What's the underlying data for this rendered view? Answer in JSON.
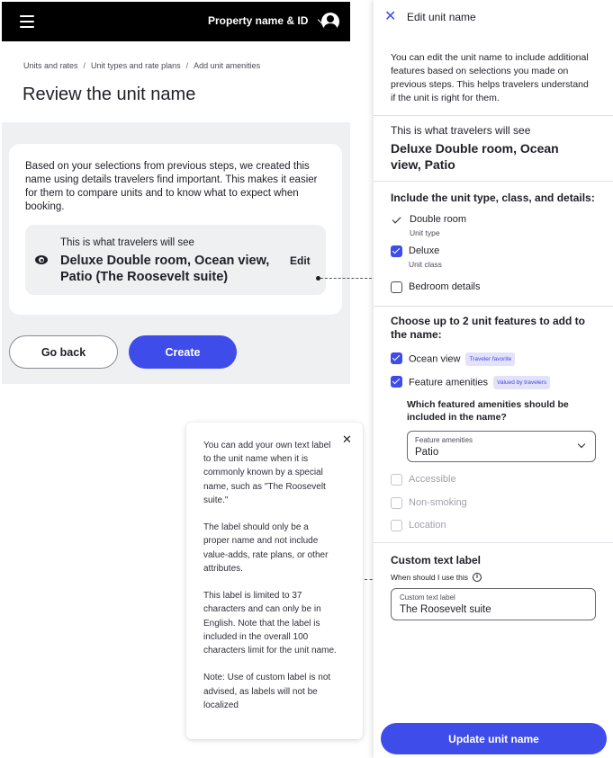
{
  "topbar": {
    "property_label": "Property name & ID"
  },
  "breadcrumb": [
    "Units and rates",
    "Unit types and rate plans",
    "Add unit amenities"
  ],
  "page_title": "Review the unit name",
  "card": {
    "description": "Based on your selections from previous steps, we created this name using details travelers find important. This makes it easier for them to compare units and to know what to expect when booking.",
    "preview_label": "This is what travelers will see",
    "preview_name": "Deluxe Double room, Ocean view, Patio (The Roosevelt suite)",
    "edit_label": "Edit"
  },
  "buttons": {
    "back": "Go back",
    "create": "Create"
  },
  "tooltip": {
    "p1": "You can add your own text label to the unit name when it is commonly known by a special name, such as \"The Roosevelt suite.\"",
    "p2": "The label should only be a proper name and not include value-adds, rate plans, or other attributes.",
    "p3": "This label is limited to 37 characters and can only be in English. Note that the label is included in the overall 100 characters limit for the unit name.",
    "p4": "Note: Use of custom label is not advised, as labels will not be localized"
  },
  "panel": {
    "title": "Edit unit name",
    "intro": "You can edit the unit name to include additional features based on selections you made on previous steps. This helps travelers understand if the unit is right for them.",
    "see_label": "This is what travelers will see",
    "see_name": "Deluxe Double room, Ocean view, Patio",
    "section_type": "Include the unit type, class, and details:",
    "opt_double": "Double room",
    "opt_double_sub": "Unit type",
    "opt_deluxe": "Deluxe",
    "opt_deluxe_sub": "Unit class",
    "opt_bedroom": "Bedroom details",
    "section_features": "Choose up to 2 unit features to add to the name:",
    "opt_ocean": "Ocean view",
    "badge_ocean": "Traveler favorite",
    "opt_amenities": "Feature amenities",
    "badge_amenities": "Valued by travelers",
    "question": "Which featured amenities should be included in the name?",
    "select_label": "Feature amenities",
    "select_value": "Patio",
    "opt_accessible": "Accessible",
    "opt_nonsmoking": "Non-smoking",
    "opt_location": "Location",
    "custom_title": "Custom text label",
    "help_text": "When should I use this",
    "field_label": "Custom text label",
    "field_value": "The Roosevelt suite",
    "update_button": "Update unit name"
  },
  "colors": {
    "accent": "#3e4ce9",
    "topbar": "#000000",
    "page_bg": "#eef0f2",
    "badge_bg": "#e4e2fb"
  },
  "icons": [
    "menu-icon",
    "chevron-down-icon",
    "account-icon",
    "eye-icon",
    "close-icon",
    "check-icon",
    "info-icon"
  ]
}
